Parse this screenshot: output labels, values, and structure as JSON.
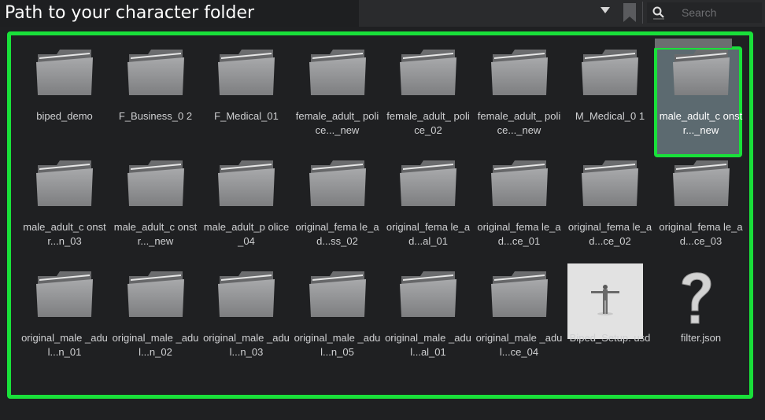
{
  "header": {
    "path_caption": "Path to your character folder",
    "search_placeholder": "Search"
  },
  "icons": {
    "dropdown": "chevron-down-icon",
    "bookmark": "bookmark-icon",
    "search": "search-icon",
    "folder": "folder-icon",
    "usd_preview": "character-preview-thumbnail",
    "unknown_file": "question-mark-icon"
  },
  "colors": {
    "highlight": "#19e03a",
    "background": "#1f2022",
    "label": "#cfd0d2",
    "selected_fill": "#5c6a70"
  },
  "items": [
    {
      "label": "biped_demo",
      "type": "folder"
    },
    {
      "label": "F_Business_0 2",
      "type": "folder"
    },
    {
      "label": "F_Medical_01",
      "type": "folder"
    },
    {
      "label": "female_adult_ police..._new",
      "type": "folder"
    },
    {
      "label": "female_adult_ police_02",
      "type": "folder"
    },
    {
      "label": "female_adult_ police..._new",
      "type": "folder"
    },
    {
      "label": "M_Medical_0 1",
      "type": "folder"
    },
    {
      "label": "male_adult_c onstr..._new",
      "type": "folder",
      "selected": true
    },
    {
      "label": "male_adult_c onstr...n_03",
      "type": "folder"
    },
    {
      "label": "male_adult_c onstr..._new",
      "type": "folder"
    },
    {
      "label": "male_adult_p olice_04",
      "type": "folder"
    },
    {
      "label": "original_fema le_ad...ss_02",
      "type": "folder"
    },
    {
      "label": "original_fema le_ad...al_01",
      "type": "folder"
    },
    {
      "label": "original_fema le_ad...ce_01",
      "type": "folder"
    },
    {
      "label": "original_fema le_ad...ce_02",
      "type": "folder"
    },
    {
      "label": "original_fema le_ad...ce_03",
      "type": "folder"
    },
    {
      "label": "original_male _adul...n_01",
      "type": "folder"
    },
    {
      "label": "original_male _adul...n_02",
      "type": "folder"
    },
    {
      "label": "original_male _adul...n_03",
      "type": "folder"
    },
    {
      "label": "original_male _adul...n_05",
      "type": "folder"
    },
    {
      "label": "original_male _adul...al_01",
      "type": "folder"
    },
    {
      "label": "original_male _adul...ce_04",
      "type": "folder"
    },
    {
      "label": "Biped_Setup. usd",
      "type": "usd"
    },
    {
      "label": "filter.json",
      "type": "json"
    }
  ]
}
